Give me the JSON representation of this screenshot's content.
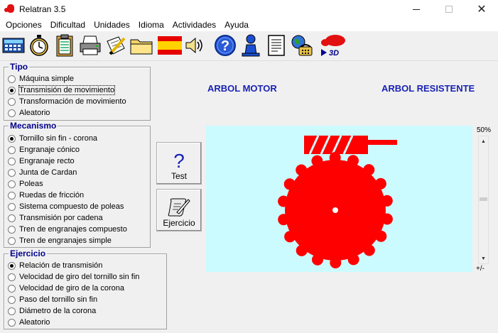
{
  "window": {
    "title": "Relatran 3.5"
  },
  "menu": [
    "Opciones",
    "Dificultad",
    "Unidades",
    "Idioma",
    "Actividades",
    "Ayuda"
  ],
  "toolbar": {
    "icons": [
      "calculator-icon",
      "stopwatch-icon",
      "clipboard-icon",
      "printer-icon",
      "edit-paper-icon",
      "folder-icon",
      "spain-flag-icon",
      "speaker-icon",
      "help-icon",
      "user-icon",
      "notes-icon",
      "globe-phone-icon",
      "3d-view-icon"
    ],
    "view3d_label": "3D"
  },
  "tipo": {
    "legend": "Tipo",
    "options": [
      "Máquina simple",
      "Transmisión de movimiento",
      "Transformación de movimiento",
      "Aleatorio"
    ],
    "selected": 1
  },
  "mecanismo": {
    "legend": "Mecanismo",
    "options": [
      "Tornillo sin fin - corona",
      "Engranaje cónico",
      "Engranaje recto",
      "Junta de Cardan",
      "Poleas",
      "Ruedas de fricción",
      "Sistema compuesto de poleas",
      "Transmisión por cadena",
      "Tren de engranajes compuesto",
      "Tren de engranajes simple"
    ],
    "selected": 0
  },
  "ejercicio": {
    "legend": "Ejercicio",
    "options": [
      "Relación de transmisión",
      "Velocidad de giro del tornillo sin fin",
      "Velocidad de giro de la corona",
      "Paso del tornillo sin fin",
      "Diámetro de la corona",
      "Aleatorio"
    ],
    "selected": 0
  },
  "buttons": {
    "test_label": "Test",
    "test_glyph": "?",
    "ejercicio_label": "Ejercicio"
  },
  "headers": {
    "motor": "ARBOL MOTOR",
    "resistente": "ARBOL RESISTENTE"
  },
  "zoom": {
    "top": "50%",
    "bottom": "+/-"
  },
  "colors": {
    "accent": "#ff0000",
    "canvas_bg": "#ccfbff",
    "legend": "#00008b",
    "header": "#1a23b5"
  }
}
